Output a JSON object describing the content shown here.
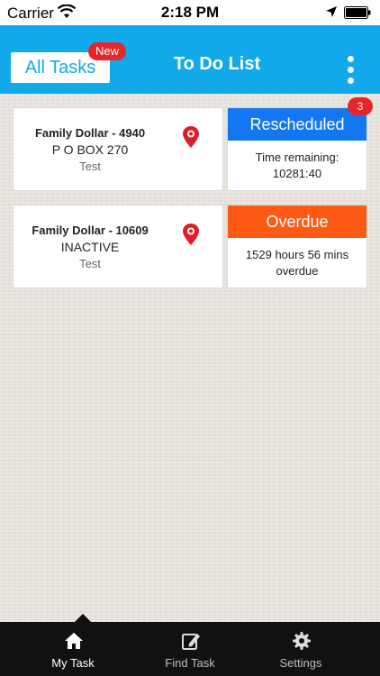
{
  "status_bar": {
    "carrier": "Carrier",
    "time": "2:18 PM"
  },
  "header": {
    "all_tasks_label": "All Tasks",
    "new_badge": "New",
    "title": "To Do List"
  },
  "tasks": [
    {
      "store": "Family Dollar - 4940",
      "address": "P O BOX 270",
      "note": "Test",
      "status": "Rescheduled",
      "status_color": "#1277f0",
      "detail_line1": "Time remaining:",
      "detail_line2": "10281:40",
      "badge": "3"
    },
    {
      "store": "Family Dollar - 10609",
      "address": "INACTIVE",
      "note": "Test",
      "status": "Overdue",
      "status_color": "#ff5a14",
      "detail_line1": "1529 hours 56 mins",
      "detail_line2": "overdue"
    }
  ],
  "tabbar": {
    "my_task": "My Task",
    "find_task": "Find Task",
    "settings": "Settings"
  },
  "colors": {
    "accent": "#12a9ea",
    "badge": "#e8262a",
    "pin": "#e01b2b"
  },
  "icons": [
    "wifi-icon",
    "location-arrow-icon",
    "battery-icon",
    "kebab-menu-icon",
    "map-pin-icon",
    "home-icon",
    "edit-icon",
    "gear-icon"
  ]
}
